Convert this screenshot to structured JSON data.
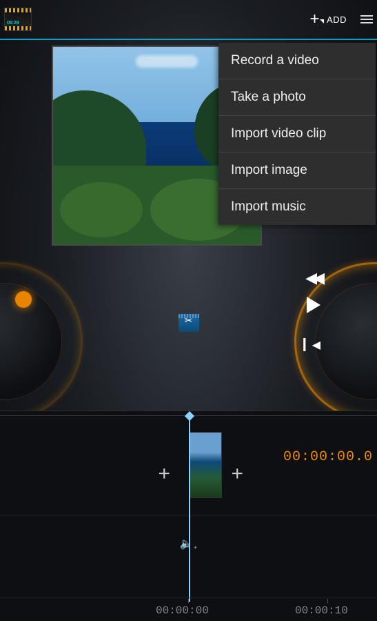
{
  "logo_text": "06:29",
  "toolbar": {
    "add_label": "ADD"
  },
  "menu": {
    "items": [
      "Record a video",
      "Take a photo",
      "Import video clip",
      "Import image",
      "Import music"
    ]
  },
  "timecode": {
    "current": "00:00:00.0"
  },
  "ruler": {
    "marks": [
      "00:00:00",
      "00:00:10"
    ]
  },
  "icons": {
    "center": "clapper-icon",
    "audio": "speaker-add-icon",
    "play": "play-icon",
    "rewind": "rewind-icon",
    "forward": "fast-forward-icon",
    "prev": "skip-back-icon"
  },
  "colors": {
    "accent": "#f08a00",
    "playhead": "#8cd2ff",
    "divider": "#1a9cc4"
  }
}
